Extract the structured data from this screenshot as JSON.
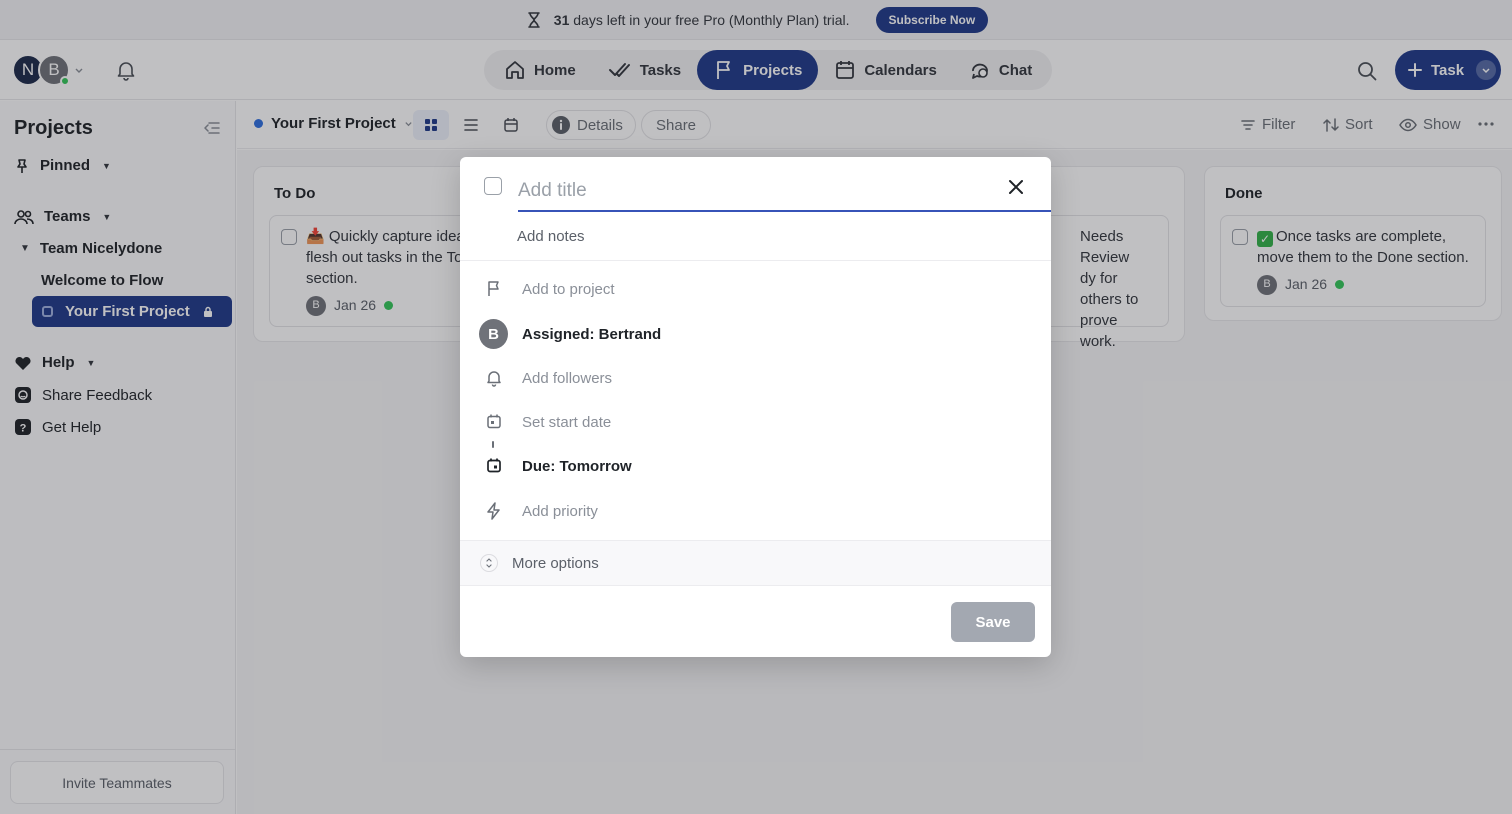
{
  "banner": {
    "days": "31",
    "text": "days left in your free Pro (Monthly Plan) trial.",
    "subscribe_label": "Subscribe Now"
  },
  "user": {
    "avatar_1": "N",
    "avatar_2": "B"
  },
  "nav": {
    "items": [
      {
        "label": "Home",
        "icon": "home-icon"
      },
      {
        "label": "Tasks",
        "icon": "double-check-icon"
      },
      {
        "label": "Projects",
        "icon": "flag-icon",
        "active": true
      },
      {
        "label": "Calendars",
        "icon": "calendar-icon"
      },
      {
        "label": "Chat",
        "icon": "chat-icon"
      }
    ],
    "new_task_label": "Task"
  },
  "sidebar": {
    "title": "Projects",
    "pinned_label": "Pinned",
    "teams_label": "Teams",
    "team_name": "Team Nicelydone",
    "welcome_label": "Welcome to Flow",
    "active_project": "Your First Project",
    "help_label": "Help",
    "share_feedback_label": "Share Feedback",
    "get_help_label": "Get Help",
    "invite_label": "Invite Teammates"
  },
  "toolbar": {
    "project_name": "Your First Project",
    "details_label": "Details",
    "share_label": "Share",
    "filter_label": "Filter",
    "sort_label": "Sort",
    "show_label": "Show"
  },
  "board": {
    "columns": [
      {
        "title": "To Do",
        "card_text": "📥 Quickly capture ideas and flesh out tasks in the To Do section.",
        "card_line1": "Quickly capture idea",
        "card_line2": "flesh out tasks in the To",
        "card_line3": "section.",
        "assignee": "B",
        "date": "Jan 26"
      },
      {
        "title": "Needs Review",
        "card_line1": "Needs Review",
        "card_line2": "dy for others to",
        "card_line3": "prove work."
      },
      {
        "title": "Done",
        "card_line1": "Once tasks are complete,",
        "card_line2": "move them to the Done section.",
        "assignee": "B",
        "date": "Jan 26"
      }
    ]
  },
  "modal": {
    "title_placeholder": "Add title",
    "notes_placeholder": "Add notes",
    "project_label": "Add to project",
    "assignee_initial": "B",
    "assigned_label": "Assigned: Bertrand",
    "followers_label": "Add followers",
    "start_date_label": "Set start date",
    "due_label": "Due: Tomorrow",
    "priority_label": "Add priority",
    "more_options_label": "More options",
    "save_label": "Save"
  },
  "colors": {
    "accent": "#1f3a8a",
    "online": "#34c759",
    "save_disabled": "#a3a8b1"
  }
}
